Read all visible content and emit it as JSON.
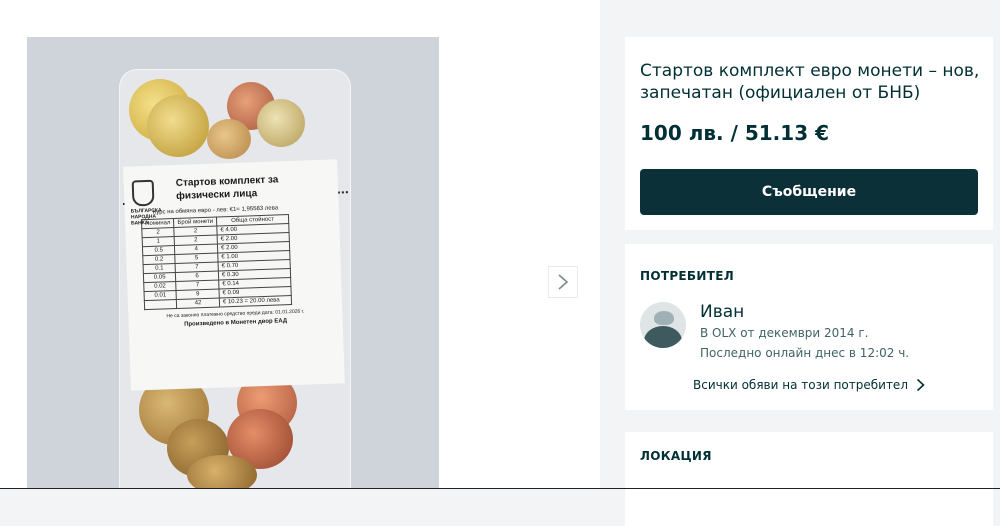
{
  "ad": {
    "title": "Стартов комплект евро монети – нов, запечатан (официален от БНБ)",
    "price": "100 лв. / 51.13 €",
    "message_button": "Съобщение"
  },
  "user": {
    "section_label": "ПОТРЕБИТЕЛ",
    "name": "Иван",
    "member_since": "В OLX от декември 2014 г.",
    "last_online": "Последно онлайн днес в 12:02 ч.",
    "all_ads_link": "Всички обяви на този потребител"
  },
  "location": {
    "section_label": "ЛОКАЦИЯ"
  },
  "photo_label": {
    "bank": "БЪЛГАРСКА НАРОДНА БАНКА",
    "title": "Стартов комплект за физически лица",
    "rate": "Курс на обмяна евро - лев: €1= 1,95583 лева",
    "headers": [
      "Номинал",
      "Брой монети",
      "Обща стойност"
    ],
    "rows": [
      [
        "2",
        "2",
        "€ 4.00"
      ],
      [
        "1",
        "2",
        "€ 2.00"
      ],
      [
        "0.5",
        "4",
        "€ 2.00"
      ],
      [
        "0.2",
        "5",
        "€ 1.00"
      ],
      [
        "0.1",
        "7",
        "€ 0.70"
      ],
      [
        "0.05",
        "6",
        "€ 0.30"
      ],
      [
        "0.02",
        "7",
        "€ 0.14"
      ],
      [
        "0.01",
        "9",
        "€ 0.09"
      ],
      [
        "",
        "42",
        "€ 10.23 = 20.00 лева"
      ]
    ],
    "footer_legal": "Не са законно платежно средство преди дата: 01.01.2026 г.",
    "footer_mint": "Произведено в Монетен двор ЕАД"
  },
  "icons": {
    "next": "chevron-right-icon",
    "all_ads": "chevron-right-icon",
    "avatar": "user-avatar-icon"
  },
  "colors": {
    "primary": "#002f34",
    "button": "#0c3037",
    "background": "#f2f4f5"
  }
}
